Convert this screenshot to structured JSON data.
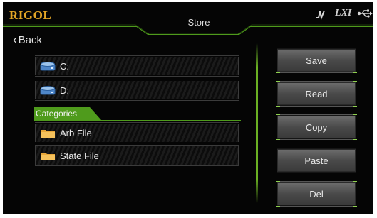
{
  "header": {
    "brand": "RIGOL",
    "title": "Store",
    "status_icons": [
      "pulse-icon",
      "lxi-icon",
      "usb-icon"
    ],
    "lxi_text": "LXI"
  },
  "nav": {
    "back_label": "Back"
  },
  "drives": [
    {
      "label": "C:",
      "icon": "disk-icon"
    },
    {
      "label": "D:",
      "icon": "disk-icon"
    }
  ],
  "categories": {
    "title": "Categories",
    "items": [
      {
        "label": "Arb File",
        "icon": "folder-icon"
      },
      {
        "label": "State File",
        "icon": "folder-icon"
      }
    ]
  },
  "actions": [
    "Save",
    "Read",
    "Copy",
    "Paste",
    "Del"
  ],
  "colors": {
    "accent": "#6ab023",
    "brand": "#e2a526",
    "background": "#050505"
  }
}
